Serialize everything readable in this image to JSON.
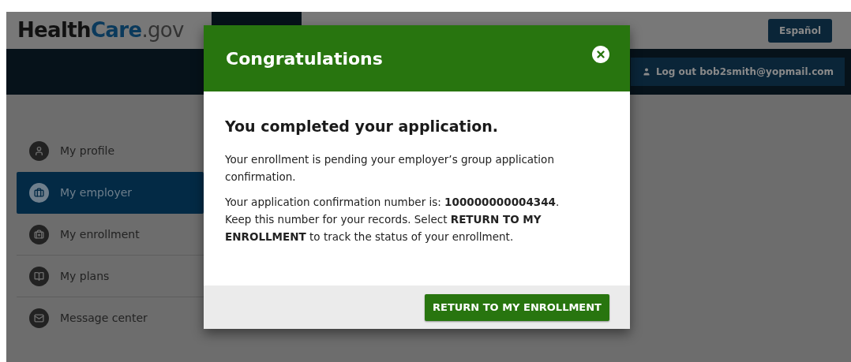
{
  "header": {
    "logo": {
      "part_1": "Health",
      "part_2": "Care",
      "part_3": ".gov"
    },
    "language_button": "Español",
    "logout_button": "Log out bob2smith@yopmail.com",
    "nav_tabs": [
      {
        "selected": true
      },
      {
        "selected": false
      }
    ]
  },
  "sidebar": {
    "items": [
      {
        "label": "My profile",
        "kind": "profile",
        "selected": false
      },
      {
        "label": "My employer",
        "kind": "employer",
        "selected": true
      },
      {
        "label": "My enrollment",
        "kind": "enrollment",
        "selected": false
      },
      {
        "label": "My plans",
        "kind": "plans",
        "selected": false
      },
      {
        "label": "Message center",
        "kind": "messages",
        "selected": false
      }
    ]
  },
  "modal": {
    "title": "Congratulations",
    "heading": "You completed your application.",
    "paragraphs": [
      "Your enrollment is pending your employer’s group application confirmation.",
      "Your application confirmation number is: **100000000004344**. Keep this number for your records. Select **RETURN TO MY ENROLLMENT** to track the status of your enrollment."
    ],
    "button": "RETURN TO MY ENROLLMENT"
  }
}
